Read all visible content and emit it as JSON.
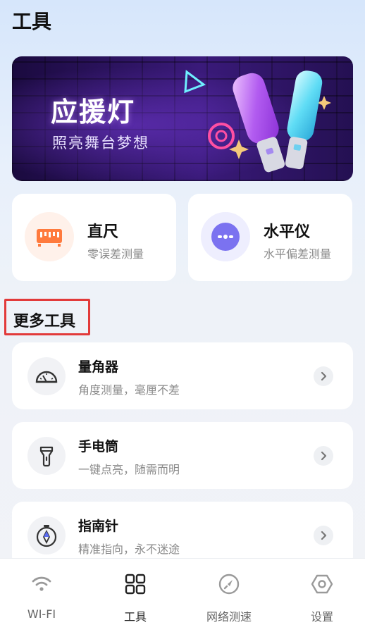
{
  "header": {
    "title": "工具"
  },
  "banner": {
    "title": "应援灯",
    "subtitle": "照亮舞台梦想"
  },
  "cards": [
    {
      "title": "直尺",
      "subtitle": "零误差测量",
      "icon": "ruler-icon",
      "color": "#ff7a3d"
    },
    {
      "title": "水平仪",
      "subtitle": "水平偏差测量",
      "icon": "level-icon",
      "color": "#7b72f0"
    }
  ],
  "section": {
    "title": "更多工具"
  },
  "tools": [
    {
      "title": "量角器",
      "subtitle": "角度测量，毫厘不差",
      "icon": "protractor-icon"
    },
    {
      "title": "手电筒",
      "subtitle": "一键点亮，随需而明",
      "icon": "flashlight-icon"
    },
    {
      "title": "指南针",
      "subtitle": "精准指向，永不迷途",
      "icon": "compass-icon"
    }
  ],
  "tabbar": {
    "items": [
      {
        "label": "WI-FI",
        "icon": "wifi-icon",
        "active": false
      },
      {
        "label": "工具",
        "icon": "grid-icon",
        "active": true
      },
      {
        "label": "网络测速",
        "icon": "speedometer-icon",
        "active": false
      },
      {
        "label": "设置",
        "icon": "hexagon-gear-icon",
        "active": false
      }
    ]
  },
  "colors": {
    "accent": "#7b72f0",
    "ruler": "#ff7a3d",
    "highlight_border": "#e23a3a"
  }
}
